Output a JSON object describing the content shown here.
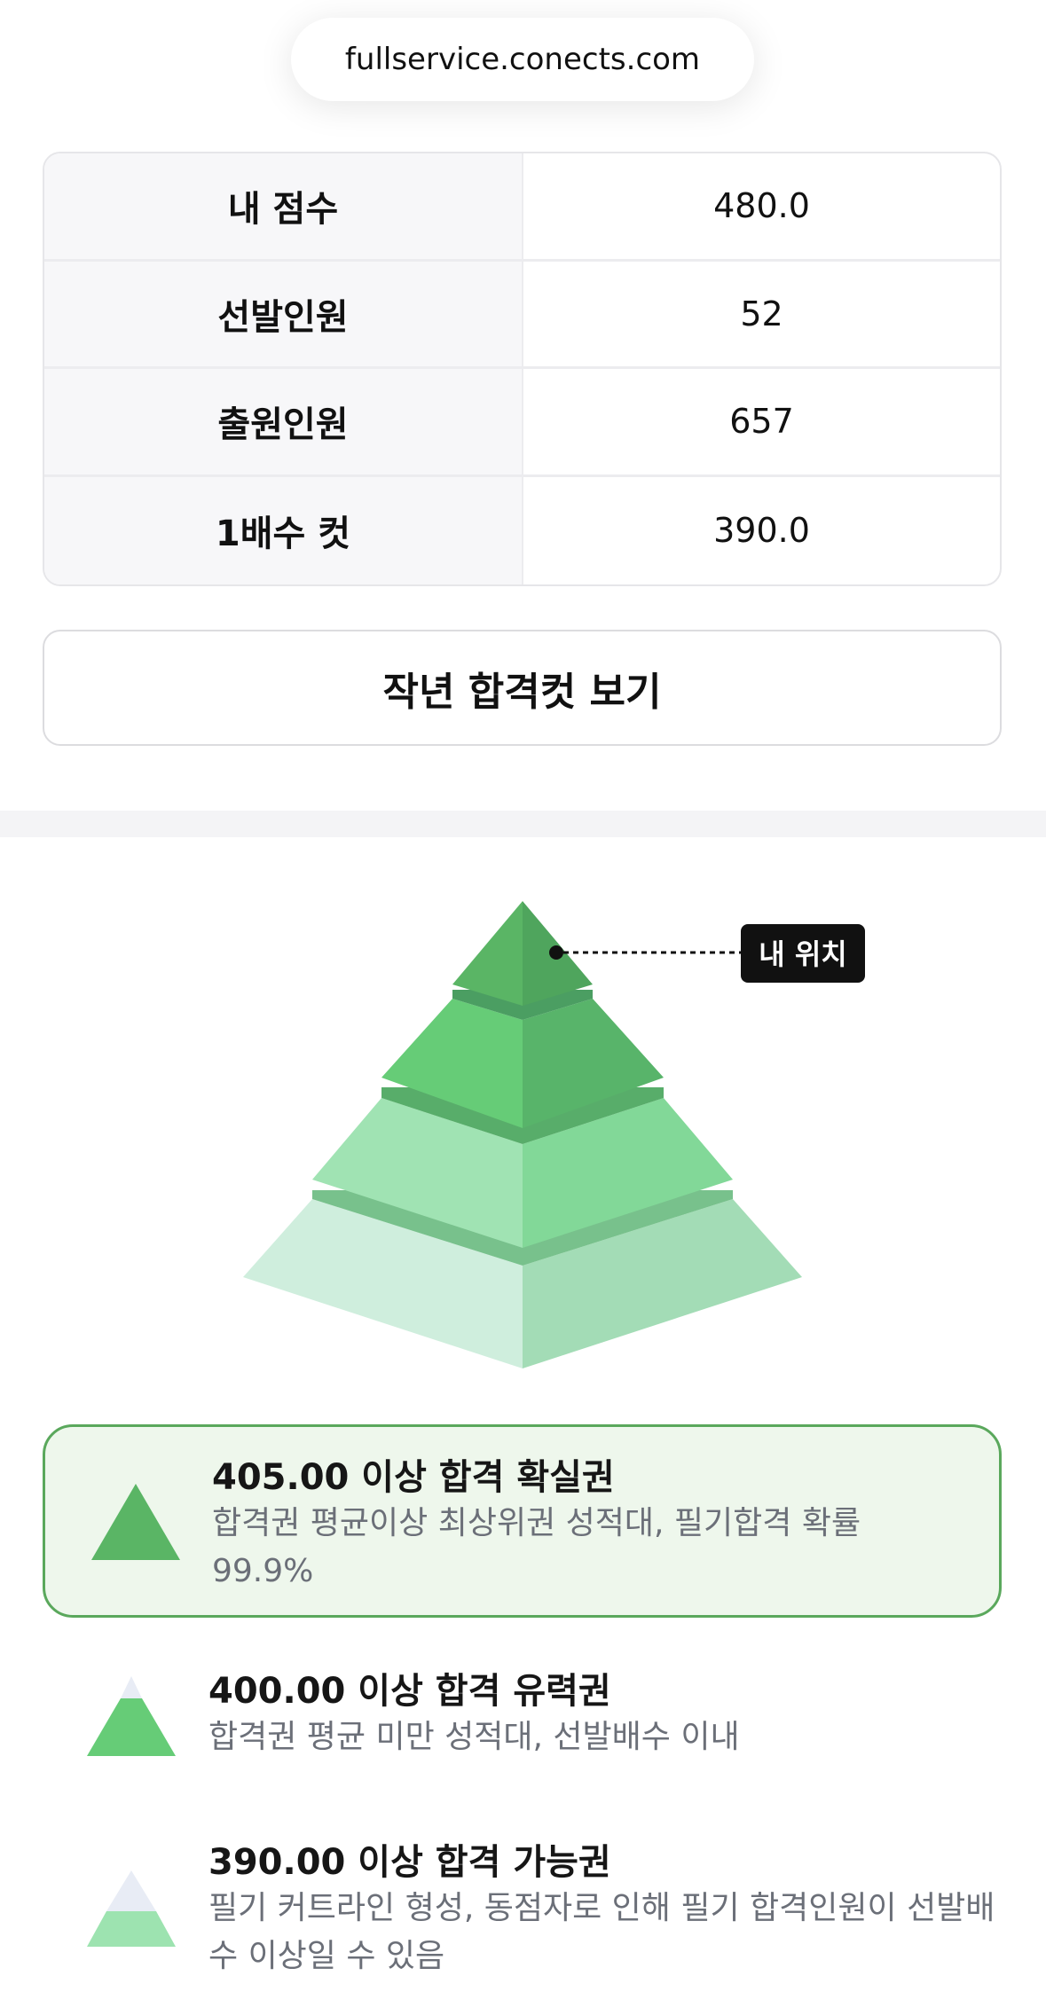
{
  "header": {
    "url": "fullservice.conects.com"
  },
  "stats": [
    {
      "label": "내 점수",
      "value": "480.0"
    },
    {
      "label": "선발인원",
      "value": "52"
    },
    {
      "label": "출원인원",
      "value": "657"
    },
    {
      "label": "1배수 컷",
      "value": "390.0"
    }
  ],
  "last_year_button": "작년 합격컷 보기",
  "pyramid": {
    "my_position_label": "내 위치",
    "colors": {
      "top": "#5ab565",
      "level2": "#66cc77",
      "level3": "#9de3b0",
      "level4": "#cfeedd"
    }
  },
  "tiers": [
    {
      "title": "405.00 이상 합격 확실권",
      "desc": "합격권 평균이상 최상위권 성적대, 필기합격 확률 99.9%",
      "active": true
    },
    {
      "title": "400.00 이상 합격 유력권",
      "desc": "합격권 평균 미만 성적대, 선발배수 이내",
      "active": false
    },
    {
      "title": "390.00 이상 합격 가능권",
      "desc": "필기 커트라인 형성, 동점자로 인해 필기 합격인원이 선발배수 이상일 수 있음",
      "active": false
    }
  ]
}
